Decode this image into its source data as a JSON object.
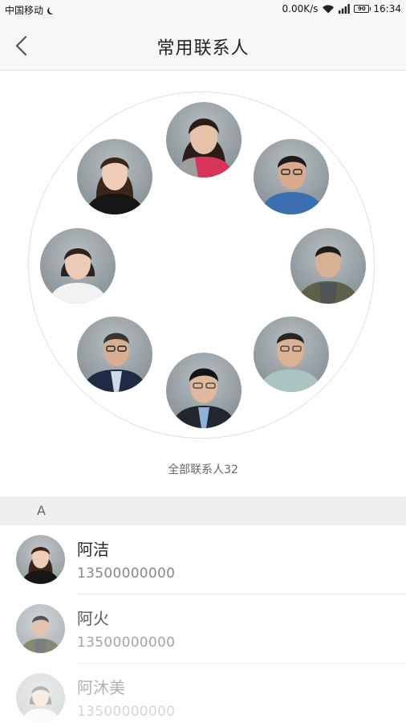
{
  "status_bar": {
    "carrier": "中国移动",
    "network_speed": "0.00K/s",
    "battery": "90",
    "time": "16:34"
  },
  "header": {
    "title": "常用联系人"
  },
  "ring": {
    "total_label": "全部联系人32"
  },
  "section": {
    "letter": "A"
  },
  "contacts": [
    {
      "name": "阿洁",
      "phone": "13500000000"
    },
    {
      "name": "阿火",
      "phone": "13500000000"
    },
    {
      "name": "阿沐美",
      "phone": "13500000000"
    }
  ],
  "colors": {
    "header_bg": "#f7f7f7",
    "section_bg": "#efefef",
    "ring_border": "#e0e0e0"
  }
}
